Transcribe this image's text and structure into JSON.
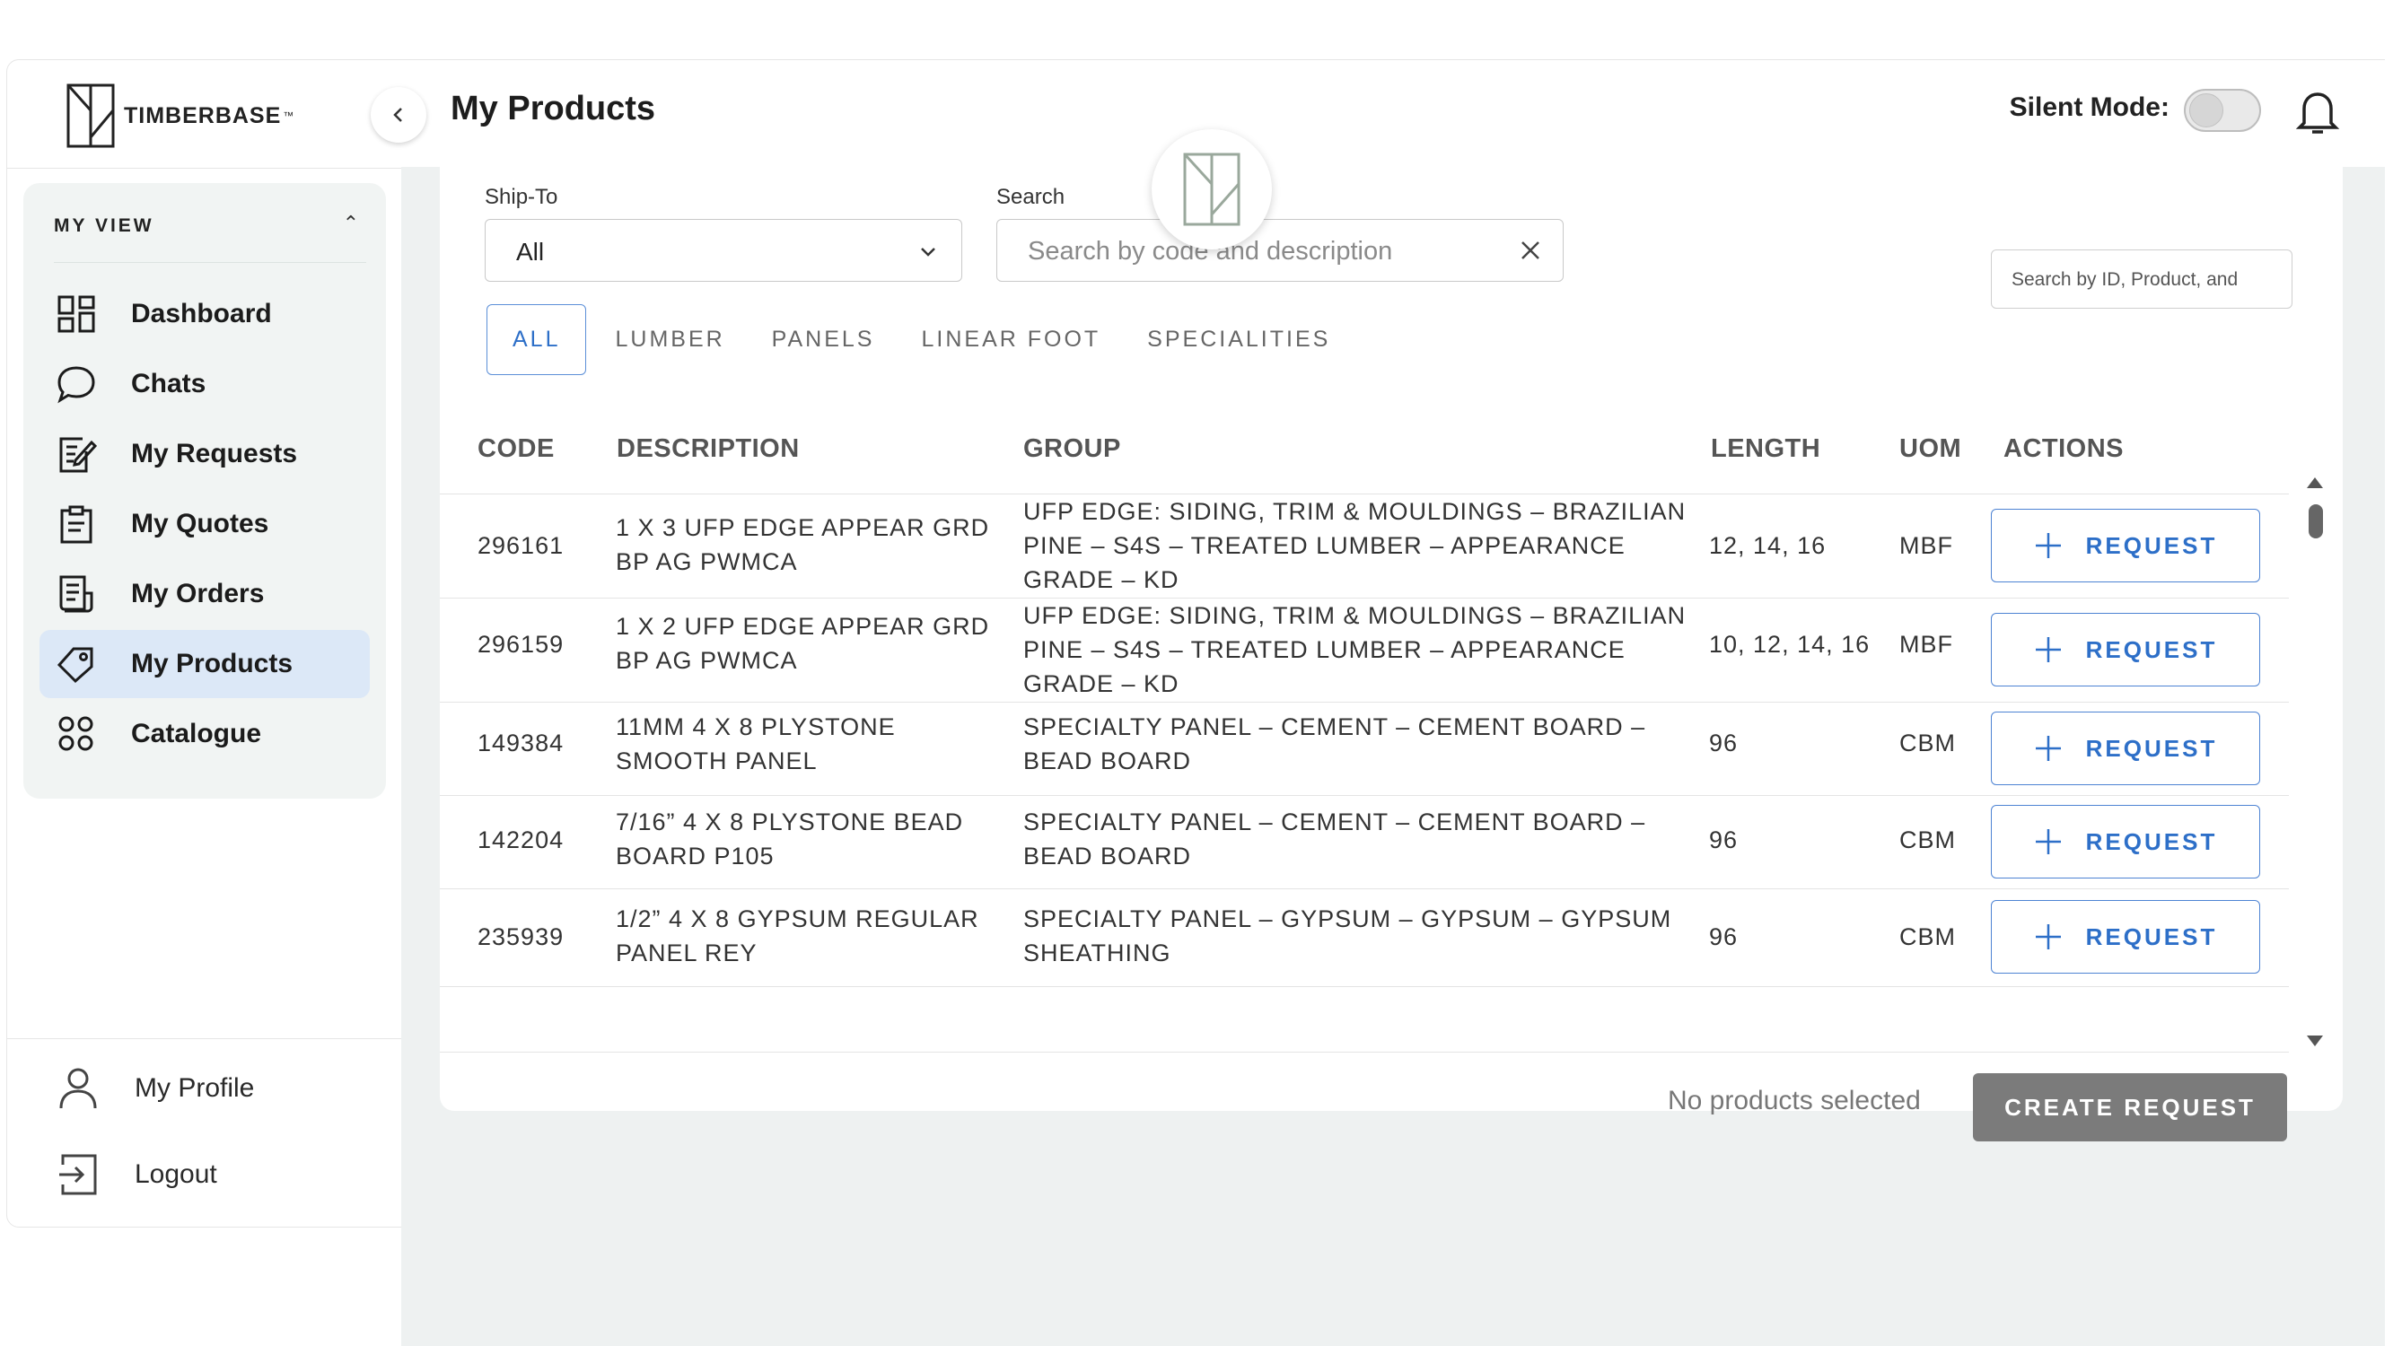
{
  "brand": {
    "name": "TIMBERBASE",
    "tm": "™"
  },
  "header": {
    "title": "My Products",
    "silent_mode_label": "Silent Mode:",
    "silent_mode_on": false
  },
  "sidebar": {
    "section_title": "MY VIEW",
    "items": [
      {
        "label": "Dashboard",
        "icon": "dashboard-icon",
        "active": false
      },
      {
        "label": "Chats",
        "icon": "chat-icon",
        "active": false
      },
      {
        "label": "My Requests",
        "icon": "requests-icon",
        "active": false
      },
      {
        "label": "My Quotes",
        "icon": "quotes-icon",
        "active": false
      },
      {
        "label": "My Orders",
        "icon": "orders-icon",
        "active": false
      },
      {
        "label": "My Products",
        "icon": "tag-icon",
        "active": true
      },
      {
        "label": "Catalogue",
        "icon": "catalogue-icon",
        "active": false
      }
    ],
    "profile_label": "My Profile",
    "logout_label": "Logout"
  },
  "filters": {
    "ship_to_label": "Ship-To",
    "ship_to_value": "All",
    "search_label": "Search",
    "search_placeholder": "Search by code and description",
    "search2_placeholder": "Search by ID, Product, and"
  },
  "tabs": [
    "ALL",
    "LUMBER",
    "PANELS",
    "LINEAR FOOT",
    "SPECIALITIES"
  ],
  "table": {
    "columns": [
      "CODE",
      "DESCRIPTION",
      "GROUP",
      "LENGTH",
      "UOM",
      "ACTIONS"
    ],
    "action_label": "REQUEST",
    "rows": [
      {
        "code": "296161",
        "description": [
          "1 X 3 UFP EDGE APPEAR GRD",
          "BP AG PWMCA"
        ],
        "group": [
          "UFP EDGE: SIDING, TRIM & MOULDINGS – BRAZILIAN",
          "PINE – S4S – TREATED LUMBER – APPEARANCE",
          "GRADE – KD"
        ],
        "length": "12, 14, 16",
        "uom": "MBF"
      },
      {
        "code": "296159",
        "description": [
          "1 X 2 UFP EDGE APPEAR GRD",
          "BP AG PWMCA"
        ],
        "group": [
          "UFP EDGE: SIDING, TRIM & MOULDINGS – BRAZILIAN",
          "PINE – S4S – TREATED LUMBER – APPEARANCE",
          "GRADE – KD"
        ],
        "length": "10, 12, 14, 16",
        "uom": "MBF"
      },
      {
        "code": "149384",
        "description": [
          "11MM 4 X 8 PLYSTONE",
          "SMOOTH PANEL"
        ],
        "group": [
          "SPECIALTY PANEL – CEMENT – CEMENT BOARD –",
          "BEAD BOARD"
        ],
        "length": "96",
        "uom": "CBM"
      },
      {
        "code": "142204",
        "description": [
          "7/16” 4 X 8 PLYSTONE BEAD",
          "BOARD P105"
        ],
        "group": [
          "SPECIALTY PANEL – CEMENT – CEMENT BOARD –",
          "BEAD BOARD"
        ],
        "length": "96",
        "uom": "CBM"
      },
      {
        "code": "235939",
        "description": [
          "1/2” 4 X 8 GYPSUM REGULAR",
          "PANEL REY"
        ],
        "group": [
          "SPECIALTY PANEL – GYPSUM – GYPSUM – GYPSUM",
          "SHEATHING"
        ],
        "length": "96",
        "uom": "CBM"
      }
    ]
  },
  "footer": {
    "selection_status": "No products selected",
    "create_label": "CREATE REQUEST"
  },
  "colors": {
    "accent": "#2d6fc8",
    "active_nav": "#dce8f7",
    "panel_bg": "#f1f4f3",
    "create_btn": "#7b7b7b"
  }
}
